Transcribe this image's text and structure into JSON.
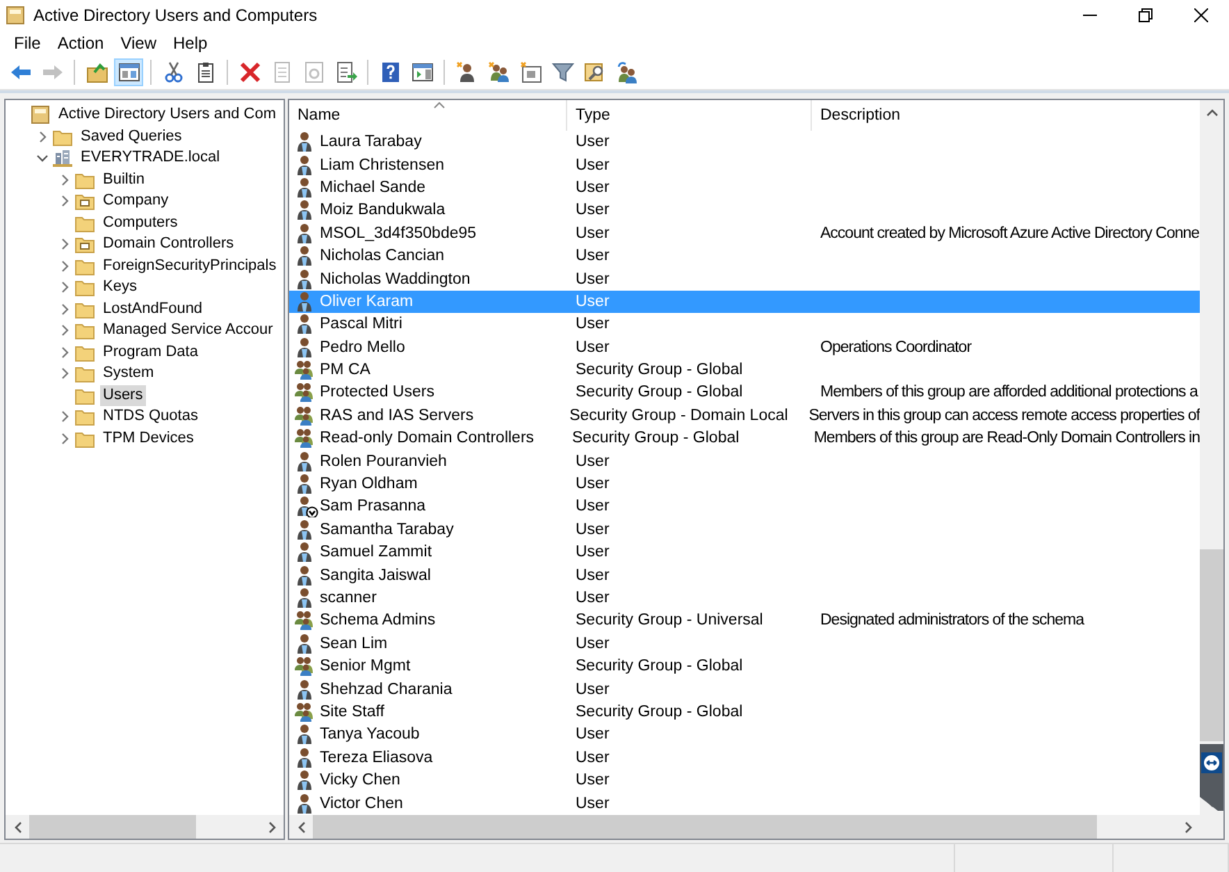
{
  "window": {
    "title": "Active Directory Users and Computers"
  },
  "menu": [
    "File",
    "Action",
    "View",
    "Help"
  ],
  "toolbar": [
    {
      "kind": "back",
      "disabled": false,
      "selected": false
    },
    {
      "kind": "forward",
      "disabled": true,
      "selected": false
    },
    {
      "kind": "sep"
    },
    {
      "kind": "up-folder",
      "disabled": false,
      "selected": false
    },
    {
      "kind": "console-tree",
      "disabled": false,
      "selected": true
    },
    {
      "kind": "sep"
    },
    {
      "kind": "cut",
      "disabled": false,
      "selected": false
    },
    {
      "kind": "paste",
      "disabled": false,
      "selected": false
    },
    {
      "kind": "sep"
    },
    {
      "kind": "delete",
      "disabled": false,
      "selected": false
    },
    {
      "kind": "properties",
      "disabled": true,
      "selected": false
    },
    {
      "kind": "refresh",
      "disabled": true,
      "selected": false
    },
    {
      "kind": "export",
      "disabled": false,
      "selected": false
    },
    {
      "kind": "sep"
    },
    {
      "kind": "help",
      "disabled": false,
      "selected": false
    },
    {
      "kind": "action-pane",
      "disabled": false,
      "selected": false
    },
    {
      "kind": "sep"
    },
    {
      "kind": "new-user",
      "disabled": false,
      "selected": false
    },
    {
      "kind": "new-group",
      "disabled": false,
      "selected": false
    },
    {
      "kind": "new-ou",
      "disabled": false,
      "selected": false
    },
    {
      "kind": "filter",
      "disabled": false,
      "selected": false
    },
    {
      "kind": "find",
      "disabled": false,
      "selected": false
    },
    {
      "kind": "add-to-group",
      "disabled": false,
      "selected": false
    }
  ],
  "tree": [
    {
      "label": "Active Directory Users and Com",
      "kind": "root",
      "expandable": false,
      "selected": false,
      "children": [
        {
          "label": "Saved Queries",
          "kind": "folder",
          "expandable": true,
          "expanded": false,
          "selected": false
        },
        {
          "label": "EVERYTRADE.local",
          "kind": "domain",
          "expandable": true,
          "expanded": true,
          "selected": false,
          "children": [
            {
              "label": "Builtin",
              "kind": "folder",
              "expandable": true,
              "expanded": false,
              "selected": false
            },
            {
              "label": "Company",
              "kind": "ou",
              "expandable": true,
              "expanded": false,
              "selected": false
            },
            {
              "label": "Computers",
              "kind": "folder",
              "expandable": false,
              "selected": false
            },
            {
              "label": "Domain Controllers",
              "kind": "ou",
              "expandable": true,
              "expanded": false,
              "selected": false
            },
            {
              "label": "ForeignSecurityPrincipals",
              "kind": "folder",
              "expandable": true,
              "expanded": false,
              "selected": false
            },
            {
              "label": "Keys",
              "kind": "folder",
              "expandable": true,
              "expanded": false,
              "selected": false
            },
            {
              "label": "LostAndFound",
              "kind": "folder",
              "expandable": true,
              "expanded": false,
              "selected": false
            },
            {
              "label": "Managed Service Accour",
              "kind": "folder",
              "expandable": true,
              "expanded": false,
              "selected": false
            },
            {
              "label": "Program Data",
              "kind": "folder",
              "expandable": true,
              "expanded": false,
              "selected": false
            },
            {
              "label": "System",
              "kind": "folder",
              "expandable": true,
              "expanded": false,
              "selected": false
            },
            {
              "label": "Users",
              "kind": "folder",
              "expandable": false,
              "selected": true
            },
            {
              "label": "NTDS Quotas",
              "kind": "folder",
              "expandable": true,
              "expanded": false,
              "selected": false
            },
            {
              "label": "TPM Devices",
              "kind": "folder",
              "expandable": true,
              "expanded": false,
              "selected": false
            }
          ]
        }
      ]
    }
  ],
  "table": {
    "columns": [
      "Name",
      "Type",
      "Description"
    ],
    "rows": [
      {
        "name": "Laura Tarabay",
        "type": "User",
        "kind": "user",
        "disabled": false,
        "selected": false
      },
      {
        "name": "Liam Christensen",
        "type": "User",
        "kind": "user",
        "disabled": false,
        "selected": false
      },
      {
        "name": "Michael Sande",
        "type": "User",
        "kind": "user",
        "disabled": false,
        "selected": false
      },
      {
        "name": "Moiz Bandukwala",
        "type": "User",
        "kind": "user",
        "disabled": false,
        "selected": false
      },
      {
        "name": "MSOL_3d4f350bde95",
        "type": "User",
        "description": "Account created by Microsoft Azure Active Directory Conne",
        "kind": "user",
        "disabled": false,
        "selected": false
      },
      {
        "name": "Nicholas Cancian",
        "type": "User",
        "kind": "user",
        "disabled": false,
        "selected": false
      },
      {
        "name": "Nicholas Waddington",
        "type": "User",
        "kind": "user",
        "disabled": false,
        "selected": false
      },
      {
        "name": "Oliver Karam",
        "type": "User",
        "kind": "user",
        "disabled": false,
        "selected": true
      },
      {
        "name": "Pascal Mitri",
        "type": "User",
        "kind": "user",
        "disabled": false,
        "selected": false
      },
      {
        "name": "Pedro Mello",
        "type": "User",
        "description": "Operations Coordinator",
        "kind": "user",
        "disabled": false,
        "selected": false
      },
      {
        "name": "PM CA",
        "type": "Security Group - Global",
        "kind": "group",
        "disabled": false,
        "selected": false
      },
      {
        "name": "Protected Users",
        "type": "Security Group - Global",
        "description": "Members of this group are afforded additional protections a",
        "kind": "group",
        "disabled": false,
        "selected": false
      },
      {
        "name": "RAS and IAS Servers",
        "type": "Security Group - Domain Local",
        "description": "Servers in this group can access remote access properties of",
        "kind": "group",
        "disabled": false,
        "selected": false
      },
      {
        "name": "Read-only Domain Controllers",
        "type": "Security Group - Global",
        "description": "Members of this group are Read-Only Domain Controllers in",
        "kind": "group",
        "disabled": false,
        "selected": false
      },
      {
        "name": "Rolen Pouranvieh",
        "type": "User",
        "kind": "user",
        "disabled": false,
        "selected": false
      },
      {
        "name": "Ryan Oldham",
        "type": "User",
        "kind": "user",
        "disabled": false,
        "selected": false
      },
      {
        "name": "Sam Prasanna",
        "type": "User",
        "kind": "user",
        "disabled": true,
        "selected": false
      },
      {
        "name": "Samantha Tarabay",
        "type": "User",
        "kind": "user",
        "disabled": false,
        "selected": false
      },
      {
        "name": "Samuel Zammit",
        "type": "User",
        "kind": "user",
        "disabled": false,
        "selected": false
      },
      {
        "name": "Sangita Jaiswal",
        "type": "User",
        "kind": "user",
        "disabled": false,
        "selected": false
      },
      {
        "name": "scanner",
        "type": "User",
        "kind": "user",
        "disabled": false,
        "selected": false
      },
      {
        "name": "Schema Admins",
        "type": "Security Group - Universal",
        "description": "Designated administrators of the schema",
        "kind": "group",
        "disabled": false,
        "selected": false
      },
      {
        "name": "Sean Lim",
        "type": "User",
        "kind": "user",
        "disabled": false,
        "selected": false
      },
      {
        "name": "Senior Mgmt",
        "type": "Security Group - Global",
        "kind": "group",
        "disabled": false,
        "selected": false
      },
      {
        "name": "Shehzad Charania",
        "type": "User",
        "kind": "user",
        "disabled": false,
        "selected": false
      },
      {
        "name": "Site Staff",
        "type": "Security Group - Global",
        "kind": "group",
        "disabled": false,
        "selected": false
      },
      {
        "name": "Tanya Yacoub",
        "type": "User",
        "kind": "user",
        "disabled": false,
        "selected": false
      },
      {
        "name": "Tereza Eliasova",
        "type": "User",
        "kind": "user",
        "disabled": false,
        "selected": false
      },
      {
        "name": "Vicky Chen",
        "type": "User",
        "kind": "user",
        "disabled": false,
        "selected": false
      },
      {
        "name": "Victor Chen",
        "type": "User",
        "kind": "user",
        "disabled": false,
        "selected": false
      }
    ]
  }
}
